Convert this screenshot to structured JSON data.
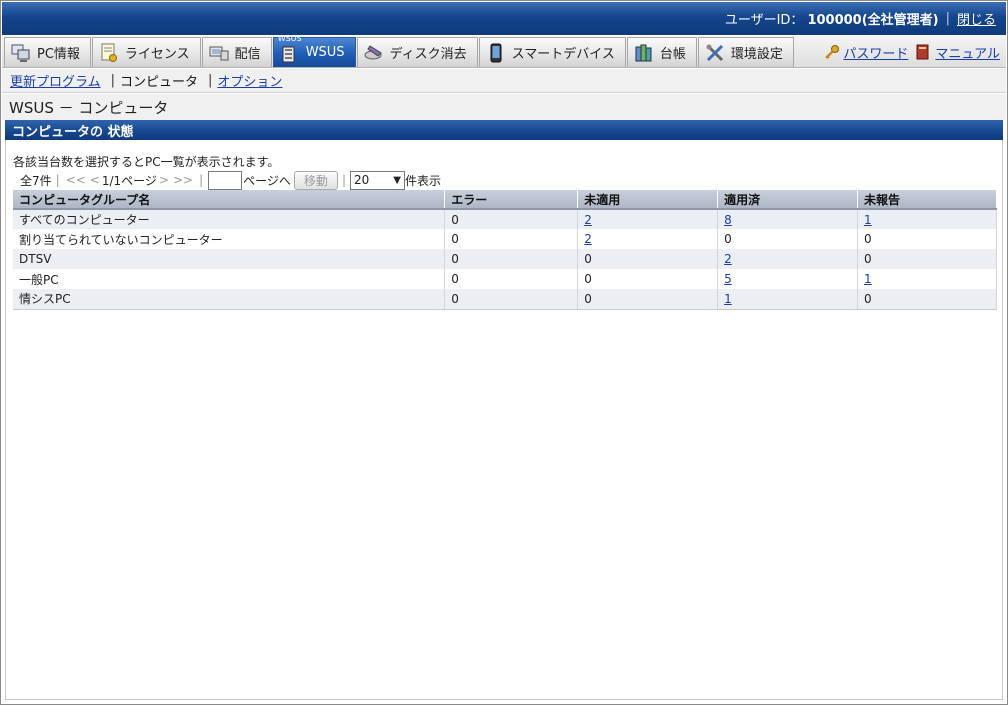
{
  "header": {
    "user_label": "ユーザーID：",
    "user_value": "100000(全社管理者)",
    "close_link": "閉じる"
  },
  "tabs": [
    {
      "label": "PC情報",
      "icon": "pc-info-icon"
    },
    {
      "label": "ライセンス",
      "icon": "license-icon"
    },
    {
      "label": "配信",
      "icon": "delivery-icon"
    },
    {
      "label": "WSUS",
      "icon": "wsus-icon",
      "active": true,
      "mini": "WSUS"
    },
    {
      "label": "ディスク消去",
      "icon": "disk-erase-icon"
    },
    {
      "label": "スマートデバイス",
      "icon": "smart-device-icon"
    },
    {
      "label": "台帳",
      "icon": "ledger-icon"
    },
    {
      "label": "環境設定",
      "icon": "settings-icon"
    }
  ],
  "right_links": {
    "password": "パスワード",
    "manual": "マニュアル"
  },
  "subnav": {
    "updates": "更新プログラム",
    "computers": "コンピュータ",
    "options": "オプション"
  },
  "page_title": "WSUS － コンピュータ",
  "section": {
    "title": "コンピュータの 状態",
    "note": "各該当台数を選択するとPC一覧が表示されます。"
  },
  "pager": {
    "total": "全7件",
    "first": "<<",
    "prev": "<",
    "page_info": "1/1ページ",
    "next": ">",
    "last": ">>",
    "page_input_value": "",
    "page_to": "ページへ",
    "move_button": "移動",
    "page_size": "20",
    "per_page": "件表示"
  },
  "table": {
    "headers": [
      "コンピュータグループ名",
      "エラー",
      "未適用",
      "適用済",
      "未報告"
    ],
    "rows": [
      {
        "name": "すべてのコンピューター",
        "error": "0",
        "not_applied": "2",
        "applied": "8",
        "not_reported": "1",
        "links": [
          false,
          true,
          true,
          true
        ]
      },
      {
        "name": "割り当てられていないコンピューター",
        "error": "0",
        "not_applied": "2",
        "applied": "0",
        "not_reported": "0",
        "links": [
          false,
          true,
          false,
          false
        ]
      },
      {
        "name": "DTSV",
        "error": "0",
        "not_applied": "0",
        "applied": "2",
        "not_reported": "0",
        "links": [
          false,
          false,
          true,
          false
        ]
      },
      {
        "name": "一般PC",
        "error": "0",
        "not_applied": "0",
        "applied": "5",
        "not_reported": "1",
        "links": [
          false,
          false,
          true,
          true
        ]
      },
      {
        "name": "情シスPC",
        "error": "0",
        "not_applied": "0",
        "applied": "1",
        "not_reported": "0",
        "links": [
          false,
          false,
          true,
          false
        ]
      }
    ]
  }
}
